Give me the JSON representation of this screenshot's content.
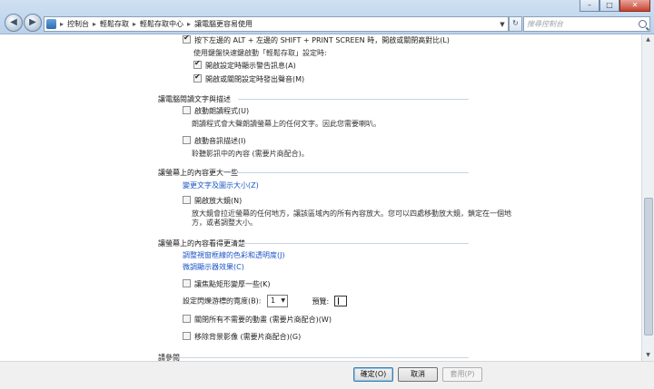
{
  "window": {
    "controls": {
      "minimize": "–",
      "maximize": "□",
      "close": "✕"
    }
  },
  "nav": {
    "back": "◀",
    "forward": "▶"
  },
  "address": {
    "crumbs": [
      "控制台",
      "輕鬆存取",
      "輕鬆存取中心",
      "讓電腦更容易使用"
    ],
    "separator": "▸",
    "dropdown": "▼",
    "refresh": "↻"
  },
  "search": {
    "placeholder": "搜尋控制台"
  },
  "content": {
    "high_contrast_shortcut": "按下左邊的 ALT + 左邊的 SHIFT + PRINT SCREEN 時，開啟或關閉高對比(L)",
    "shortcut_settings_label": "使用鍵盤快速鍵啟動「輕鬆存取」設定時:",
    "show_warning": "開啟設定時顯示警告訊息(A)",
    "play_sound": "開啟或關閉設定時發出聲音(M)",
    "section_read_text": "讓電腦閱讀文字與描述",
    "narrator_label": "啟動朗讀程式(U)",
    "narrator_desc": "朗讀程式會大聲朗讀螢幕上的任何文字。因此您需要喇叭。",
    "audio_desc_label": "啟動音訊描述(I)",
    "audio_desc_desc": "聆聽影訊中的內容 (需要片商配合)。",
    "section_bigger": "讓螢幕上的內容更大一些",
    "change_text_size_link": "變更文字及圖示大小(Z)",
    "magnifier_label": "開啟放大鏡(N)",
    "magnifier_desc1": "放大鏡會拉近螢幕的任何地方，讓該區域內的所有內容放大。您可以四處移動放大鏡，鎖定在一個地",
    "magnifier_desc2": "方，或者調整大小。",
    "section_easier": "讓螢幕上的內容看得更清楚",
    "color_link": "調整視窗框線的色彩和透明度(J)",
    "fine_tune_link": "微調顯示器效果(C)",
    "focus_rect_label": "讓焦點矩形變厚一些(K)",
    "cursor_width_label": "設定閃爍游標的寬度(B):",
    "cursor_width_value": "1",
    "cursor_width_arrow": "▼",
    "preview_label": "預覽:",
    "animations_label": "關閉所有不需要的動畫 (需要片商配合)(W)",
    "bg_images_label": "移除背景影像 (需要片商配合)(G)",
    "section_see_also": "請參閱"
  },
  "footer": {
    "ok": "確定(O)",
    "cancel": "取消",
    "apply": "套用(P)"
  },
  "state": {
    "high_contrast_checked": true,
    "show_warning_checked": true,
    "play_sound_checked": true
  }
}
